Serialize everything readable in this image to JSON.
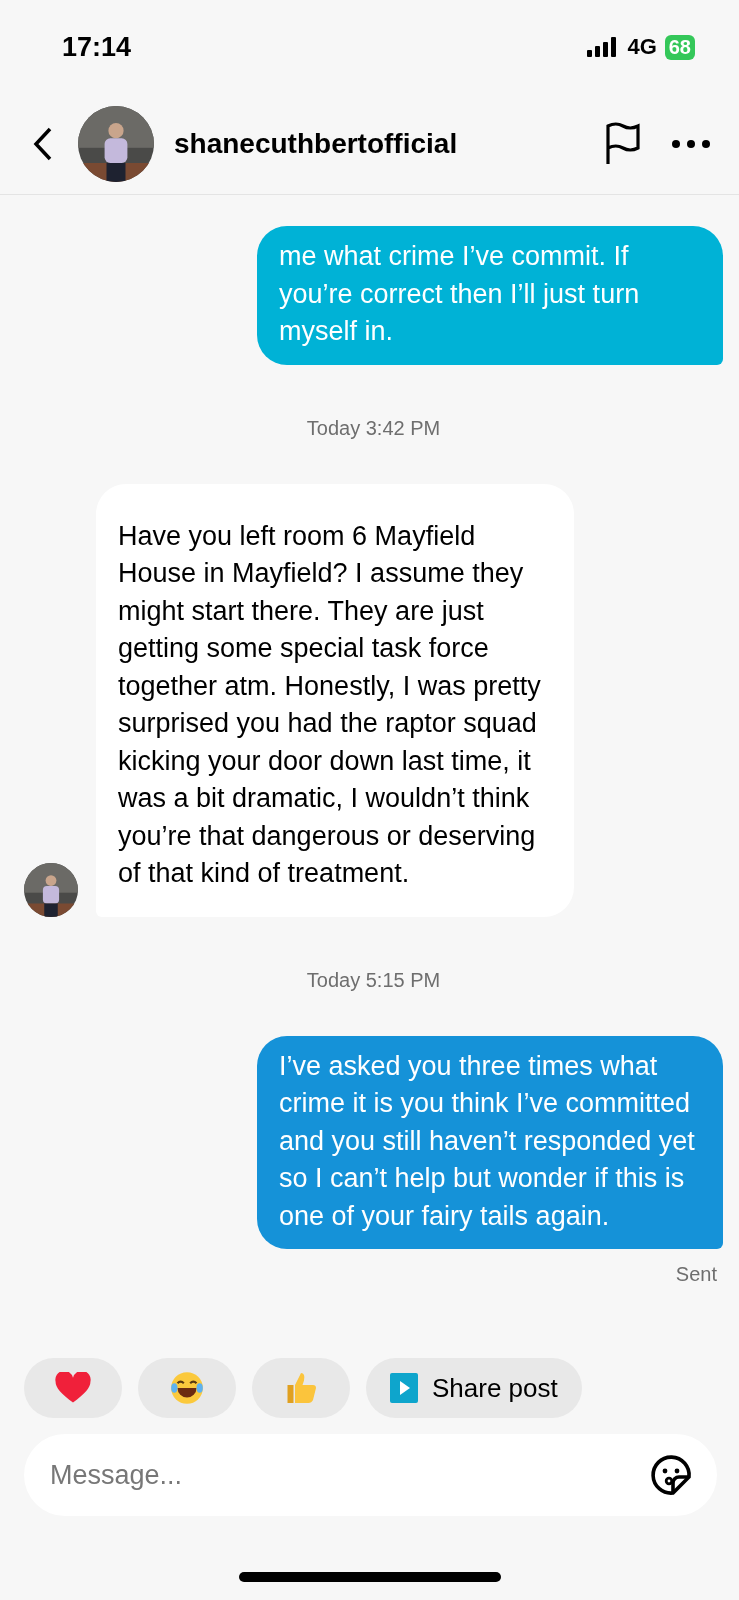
{
  "status_bar": {
    "time": "17:14",
    "network": "4G",
    "battery": "68"
  },
  "header": {
    "username": "shanecuthbertofficial"
  },
  "messages": [
    {
      "kind": "sent",
      "color": "#00b2d6",
      "text": "me what crime I’ve commit. If you’re correct then I’ll just turn myself in."
    },
    {
      "kind": "timestamp",
      "text": "Today 3:42 PM"
    },
    {
      "kind": "received",
      "text": "Have you left room 6 Mayfield House in Mayfield? I assume they might start there. They are just getting some special task force together atm. Honestly, I was pretty surprised you had the raptor squad kicking your door down last time, it was a bit dramatic, I wouldn’t think you’re that dangerous or deserving of that kind of treatment."
    },
    {
      "kind": "timestamp",
      "text": "Today 5:15 PM"
    },
    {
      "kind": "sent",
      "color": "#1592d8",
      "text": "I’ve asked you three times what crime it is you think I’ve committed and you still haven’t responded yet so I can’t help but wonder if this is one of your fairy tails again."
    },
    {
      "kind": "status",
      "text": "Sent"
    }
  ],
  "quick_replies": [
    {
      "kind": "heart"
    },
    {
      "kind": "laugh"
    },
    {
      "kind": "thumbs_up"
    },
    {
      "kind": "share",
      "label": "Share post"
    }
  ],
  "composer": {
    "placeholder": "Message..."
  }
}
